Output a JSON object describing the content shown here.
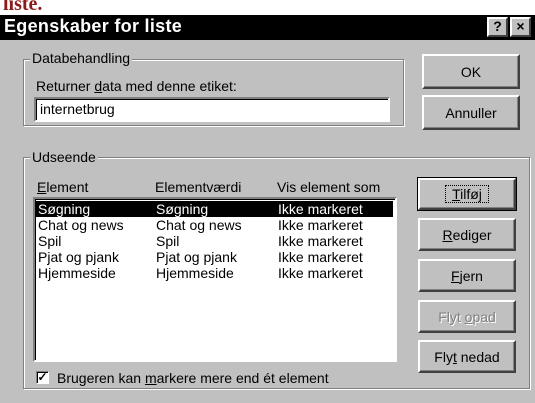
{
  "page": {
    "caption": "liste."
  },
  "dialog": {
    "title": "Egenskaber for liste",
    "help_label": "?",
    "close_label": "×"
  },
  "data_group": {
    "legend": "Databehandling",
    "label_pre": "Returner ",
    "label_ul": "d",
    "label_post": "ata med denne etiket:",
    "input_value": "internetbrug"
  },
  "buttons": {
    "ok": "OK",
    "cancel": "Annuller",
    "add_ul": "T",
    "add_rest": "ilføj",
    "edit_ul": "R",
    "edit_rest": "ediger",
    "remove_ul": "F",
    "remove_rest": "jern",
    "move_up_pre": "Flyt ",
    "move_up_ul": "o",
    "move_up_rest": "pad",
    "move_down_pre": "Fly",
    "move_down_ul": "t",
    "move_down_rest": " nedad"
  },
  "appearance_group": {
    "legend": "Udseende",
    "columns": {
      "element_ul": "E",
      "element_rest": "lement",
      "value": "Elementværdi",
      "show_as": "Vis element som"
    },
    "rows": [
      {
        "element": "Søgning",
        "value": "Søgning",
        "show_as": "Ikke markeret",
        "selected": true
      },
      {
        "element": "Chat og news",
        "value": "Chat og news",
        "show_as": "Ikke markeret",
        "selected": false
      },
      {
        "element": "Spil",
        "value": "Spil",
        "show_as": "Ikke markeret",
        "selected": false
      },
      {
        "element": "Pjat og pjank",
        "value": "Pjat og pjank",
        "show_as": "Ikke markeret",
        "selected": false
      },
      {
        "element": "Hjemmeside",
        "value": "Hjemmeside",
        "show_as": "Ikke markeret",
        "selected": false
      }
    ],
    "checkbox": {
      "checked": true,
      "mark": "✓",
      "label_pre": "Brugeren kan ",
      "label_ul": "m",
      "label_post": "arkere mere end ét element"
    }
  },
  "colors": {
    "dialog_bg": "#c0c0c0",
    "titlebar_bg": "#000000",
    "caption_color": "#8b1a1a",
    "selection_bg": "#000000"
  }
}
